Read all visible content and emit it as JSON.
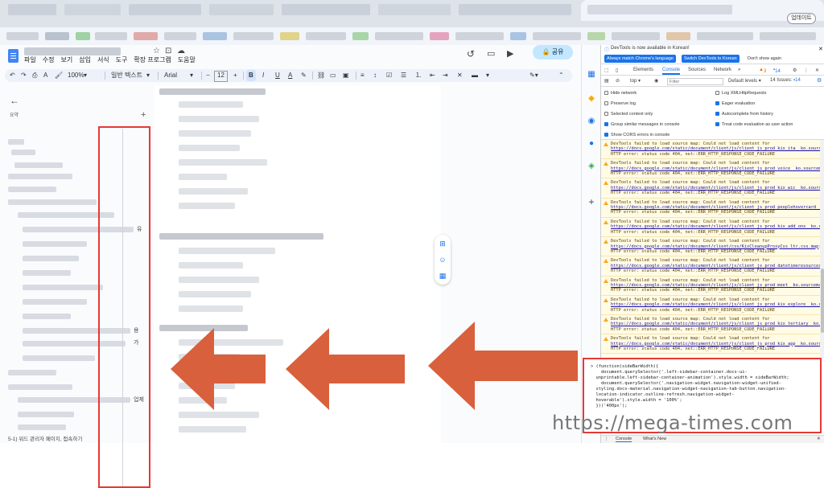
{
  "browser": {
    "update_button": "업데이트"
  },
  "docs": {
    "menu": [
      "파일",
      "수정",
      "보기",
      "삽입",
      "서식",
      "도구",
      "확장 프로그램",
      "도움말"
    ],
    "share_button": "공유",
    "toolbar": {
      "zoom": "100%",
      "style": "일반 텍스트",
      "font": "Arial",
      "font_size": "12",
      "bold": "B",
      "italic": "I",
      "underline": "U",
      "text_color": "A"
    },
    "left_panel": {
      "summary_label": "요약",
      "plus": "+",
      "frag1": "유",
      "frag2": "용",
      "frag3": "가",
      "frag4": "업제",
      "bottom_text": "5-1) 워드 관리자 페이지, 접속하기"
    }
  },
  "devtools": {
    "banner": "DevTools is now available in Korean!",
    "btn_match": "Always match Chrome's language",
    "btn_switch": "Switch DevTools to Korean",
    "btn_dont_show": "Don't show again",
    "tabs": [
      "Elements",
      "Console",
      "Sources",
      "Network"
    ],
    "more_tabs": "»",
    "warn_count": "3",
    "msg_count": "14",
    "top_context": "top",
    "filter_placeholder": "Filter",
    "levels": "Default levels",
    "issues": "14 Issues:",
    "issues_count": "14",
    "settings_left": [
      "Hide network",
      "Preserve log",
      "Selected context only",
      "Group similar messages in console",
      "Show CORS errors in console"
    ],
    "settings_left_checked": [
      false,
      false,
      false,
      true,
      true
    ],
    "settings_right": [
      "Log XMLHttpRequests",
      "Eager evaluation",
      "Autocomplete from history",
      "Treat code evaluation as user action"
    ],
    "settings_right_checked": [
      false,
      true,
      true,
      true
    ],
    "warnings": [
      {
        "pre": "DevTools failed to load source map: Could not load content for ",
        "link": "https://docs.google.com/static/document/client/js/client_js_prod_kix_ita__ko.sourcemap",
        "post": ": HTTP error: status code 404, net::ERR_HTTP_RESPONSE_CODE_FAILURE"
      },
      {
        "pre": "DevTools failed to load source map: Could not load content for ",
        "link": "https://docs.google.com/static/document/client/js/client_js_prod_voice__ko.sourcemap",
        "post": ": HTTP error: status code 404, net::ERR_HTTP_RESPONSE_CODE_FAILURE"
      },
      {
        "pre": "DevTools failed to load source map: Could not load content for ",
        "link": "https://docs.google.com/static/document/client/js/client_js_prod_kix_wic__ko.sourcemap",
        "post": ": HTTP error: status code 404, net::ERR_HTTP_RESPONSE_CODE_FAILURE"
      },
      {
        "pre": "DevTools failed to load source map: Could not load content for ",
        "link": "https://docs.google.com/static/document/client/js/client_js_prod_peoplehovercard__ko.sourcemap",
        "post": ": HTTP error: status code 404, net::ERR_HTTP_RESPONSE_CODE_FAILURE"
      },
      {
        "pre": "DevTools failed to load source map: Could not load content for ",
        "link": "https://docs.google.com/static/document/client/js/client_js_prod_kix_add_ons__ko.sourcemap",
        "post": ": HTTP error: status code 404, net::ERR_HTTP_RESPONSE_CODE_FAILURE"
      },
      {
        "pre": "DevTools failed to load source map: Could not load content for ",
        "link": "https://docs.google.com/static/document/client/css/KixCleanupProxyCss_ltr.css.map",
        "post": ": HTTP error: status code 404, net::ERR_HTTP_RESPONSE_CODE_FAILURE"
      },
      {
        "pre": "DevTools failed to load source map: Could not load content for ",
        "link": "https://docs.google.com/static/document/client/js/client_js_prod_datetimeresources__ko.sourcemap",
        "post": ": HTTP error: status code 404, net::ERR_HTTP_RESPONSE_CODE_FAILURE"
      },
      {
        "pre": "DevTools failed to load source map: Could not load content for ",
        "link": "https://docs.google.com/static/document/client/js/client_js_prod_meet__ko.sourcemap",
        "post": ": HTTP error: status code 404, net::ERR_HTTP_RESPONSE_CODE_FAILURE"
      },
      {
        "pre": "DevTools failed to load source map: Could not load content for ",
        "link": "https://docs.google.com/static/document/client/js/client_js_prod_kix_explore__ko.sourcemap",
        "post": ": HTTP error: status code 404, net::ERR_HTTP_RESPONSE_CODE_FAILURE"
      },
      {
        "pre": "DevTools failed to load source map: Could not load content for ",
        "link": "https://docs.google.com/static/document/client/js/client_js_prod_kix_tertiary__ko.sourcemap",
        "post": ": HTTP error: status code 404, net::ERR_HTTP_RESPONSE_CODE_FAILURE"
      },
      {
        "pre": "DevTools failed to load source map: Could not load content for ",
        "link": "https://docs.google.com/static/document/client/js/client_js_prod_kix_app__ko.sourcemap",
        "post": ": HTTP error: status code 404, net::ERR_HTTP_RESPONSE_CODE_FAILURE"
      }
    ],
    "code_lines": [
      "> (function(sideBarWidth){",
      "    document.querySelector('.left-sidebar-container.docs-ui-",
      "  unprintable.left-sidebar-container-animation').style.width = sideBarWidth;",
      "    document.querySelector('.navigation-widget.navigation-widget-unified-",
      "  styling.docs-material.navigation-widget-navigation-tab-button.navigation-",
      "  location-indicator.outline-refresh.navigation-widget-",
      "  hoverable').style.width = '100%';",
      "  })('400px');"
    ],
    "drawer_tabs": [
      "Console",
      "What's New"
    ]
  },
  "watermark": "https://mega-times.com",
  "colors": {
    "annotation_red": "#e53935",
    "arrow_orange": "#d9603c",
    "accent_blue": "#1a73e8"
  }
}
